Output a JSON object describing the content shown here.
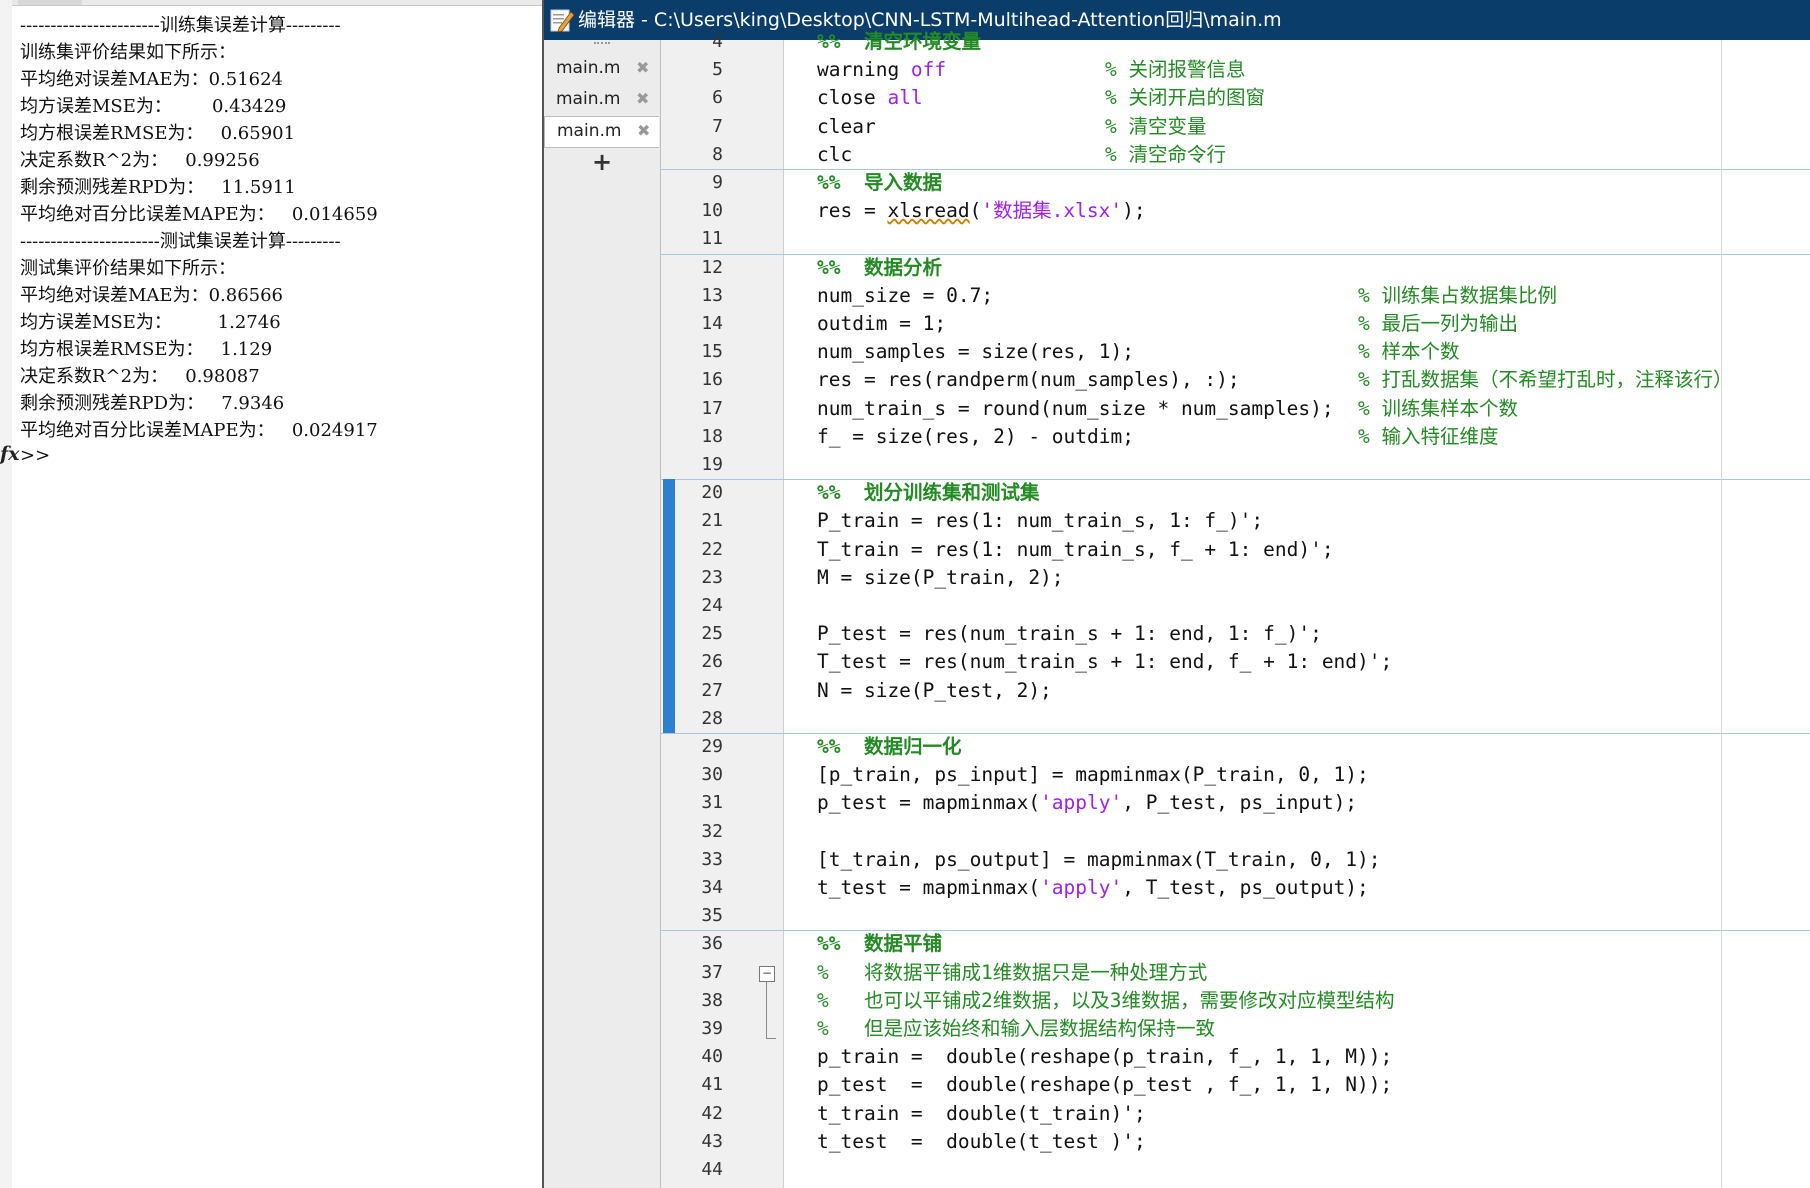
{
  "command_window": {
    "lines": [
      "-----------------------训练集误差计算---------",
      "训练集评价结果如下所示：",
      "平均绝对误差MAE为：0.51624",
      "均方误差MSE为：       0.43429",
      "均方根误差RMSE为：   0.65901",
      "决定系数R^2为：   0.99256",
      "剩余预测残差RPD为：   11.5911",
      "平均绝对百分比误差MAPE为：   0.014659",
      "-----------------------测试集误差计算---------",
      "测试集评价结果如下所示：",
      "平均绝对误差MAE为：0.86566",
      "均方误差MSE为：        1.2746",
      "均方根误差RMSE为：   1.129",
      "决定系数R^2为：   0.98087",
      "剩余预测残差RPD为：   7.9346",
      "平均绝对百分比误差MAPE为：   0.024917"
    ],
    "fx_label": "fx",
    "prompt": ">>"
  },
  "editor": {
    "title": "编辑器 - C:\\Users\\king\\Desktop\\CNN-LSTM-Multihead-Attention回归\\main.m",
    "tabs": [
      {
        "label": "main.m",
        "close": "✖",
        "active": false
      },
      {
        "label": "main.m",
        "close": "✖",
        "active": false
      },
      {
        "label": "main.m",
        "close": "✖",
        "active": true
      }
    ],
    "add_tab": "+",
    "fold_toggle": "−",
    "lines": [
      {
        "n": "4",
        "segs": [
          {
            "t": "%%  清空环境变量",
            "c": "green bold"
          }
        ]
      },
      {
        "n": "5",
        "segs": [
          {
            "t": "warning "
          },
          {
            "t": "off",
            "c": "kw"
          }
        ],
        "cmt": {
          "t": "% 关闭报警信息",
          "col": "a"
        }
      },
      {
        "n": "6",
        "segs": [
          {
            "t": "close "
          },
          {
            "t": "all",
            "c": "kw"
          }
        ],
        "cmt": {
          "t": "% 关闭开启的图窗",
          "col": "a"
        }
      },
      {
        "n": "7",
        "segs": [
          {
            "t": "clear"
          }
        ],
        "cmt": {
          "t": "% 清空变量",
          "col": "a"
        }
      },
      {
        "n": "8",
        "segs": [
          {
            "t": "clc"
          }
        ],
        "cmt": {
          "t": "% 清空命令行",
          "col": "a"
        }
      },
      {
        "n": "9",
        "segs": [
          {
            "t": "%%  导入数据",
            "c": "green bold"
          }
        ]
      },
      {
        "n": "10",
        "segs": [
          {
            "t": "res = "
          },
          {
            "t": "xlsread",
            "c": "wavy"
          },
          {
            "t": "("
          },
          {
            "t": "'数据集.xlsx'",
            "c": "str"
          },
          {
            "t": ");"
          }
        ]
      },
      {
        "n": "11",
        "segs": []
      },
      {
        "n": "12",
        "segs": [
          {
            "t": "%%  数据分析",
            "c": "green bold"
          }
        ]
      },
      {
        "n": "13",
        "segs": [
          {
            "t": "num_size = 0.7;"
          }
        ],
        "cmt": {
          "t": "% 训练集占数据集比例",
          "col": "b"
        }
      },
      {
        "n": "14",
        "segs": [
          {
            "t": "outdim = 1;"
          }
        ],
        "cmt": {
          "t": "% 最后一列为输出",
          "col": "b"
        }
      },
      {
        "n": "15",
        "segs": [
          {
            "t": "num_samples = size(res, 1);"
          }
        ],
        "cmt": {
          "t": "% 样本个数",
          "col": "b"
        }
      },
      {
        "n": "16",
        "segs": [
          {
            "t": "res = res(randperm(num_samples), :);"
          }
        ],
        "cmt": {
          "t": "% 打乱数据集（不希望打乱时，注释该行）",
          "col": "b"
        }
      },
      {
        "n": "17",
        "segs": [
          {
            "t": "num_train_s = round(num_size * num_samples);"
          }
        ],
        "cmt": {
          "t": "% 训练集样本个数",
          "col": "b"
        }
      },
      {
        "n": "18",
        "segs": [
          {
            "t": "f_ = size(res, 2) - outdim;"
          }
        ],
        "cmt": {
          "t": "% 输入特征维度",
          "col": "b"
        }
      },
      {
        "n": "19",
        "segs": []
      },
      {
        "n": "20",
        "segs": [
          {
            "t": "%%  划分训练集和测试集",
            "c": "green bold"
          }
        ]
      },
      {
        "n": "21",
        "segs": [
          {
            "t": "P_train = res(1: num_train_s, 1: f_)';"
          }
        ]
      },
      {
        "n": "22",
        "segs": [
          {
            "t": "T_train = res(1: num_train_s, f_ + 1: end)';"
          }
        ]
      },
      {
        "n": "23",
        "segs": [
          {
            "t": "M = size(P_train, 2);"
          }
        ]
      },
      {
        "n": "24",
        "segs": []
      },
      {
        "n": "25",
        "segs": [
          {
            "t": "P_test = res(num_train_s + 1: end, 1: f_)';"
          }
        ]
      },
      {
        "n": "26",
        "segs": [
          {
            "t": "T_test = res(num_train_s + 1: end, f_ + 1: end)';"
          }
        ]
      },
      {
        "n": "27",
        "segs": [
          {
            "t": "N = size(P_test, 2);"
          }
        ]
      },
      {
        "n": "28",
        "segs": []
      },
      {
        "n": "29",
        "segs": [
          {
            "t": "%%  数据归一化",
            "c": "green bold"
          }
        ]
      },
      {
        "n": "30",
        "segs": [
          {
            "t": "[p_train, ps_input] = mapminmax(P_train, 0, 1);"
          }
        ]
      },
      {
        "n": "31",
        "segs": [
          {
            "t": "p_test = mapminmax("
          },
          {
            "t": "'apply'",
            "c": "str"
          },
          {
            "t": ", P_test, ps_input);"
          }
        ]
      },
      {
        "n": "32",
        "segs": []
      },
      {
        "n": "33",
        "segs": [
          {
            "t": "[t_train, ps_output] = mapminmax(T_train, 0, 1);"
          }
        ]
      },
      {
        "n": "34",
        "segs": [
          {
            "t": "t_test = mapminmax("
          },
          {
            "t": "'apply'",
            "c": "str"
          },
          {
            "t": ", T_test, ps_output);"
          }
        ]
      },
      {
        "n": "35",
        "segs": []
      },
      {
        "n": "36",
        "segs": [
          {
            "t": "%%  数据平铺",
            "c": "green bold"
          }
        ]
      },
      {
        "n": "37",
        "segs": [
          {
            "t": "%   将数据平铺成1维数据只是一种处理方式",
            "c": "green"
          }
        ]
      },
      {
        "n": "38",
        "segs": [
          {
            "t": "%   也可以平铺成2维数据，以及3维数据，需要修改对应模型结构",
            "c": "green"
          }
        ]
      },
      {
        "n": "39",
        "segs": [
          {
            "t": "%   但是应该始终和输入层数据结构保持一致",
            "c": "green"
          }
        ]
      },
      {
        "n": "40",
        "segs": [
          {
            "t": "p_train =  double(reshape(p_train, f_, 1, 1, M));"
          }
        ]
      },
      {
        "n": "41",
        "segs": [
          {
            "t": "p_test  =  double(reshape(p_test , f_, 1, 1, N));"
          }
        ]
      },
      {
        "n": "42",
        "segs": [
          {
            "t": "t_train =  double(t_train)';"
          }
        ]
      },
      {
        "n": "43",
        "segs": [
          {
            "t": "t_test  =  double(t_test )';"
          }
        ]
      },
      {
        "n": "44",
        "segs": []
      }
    ]
  }
}
